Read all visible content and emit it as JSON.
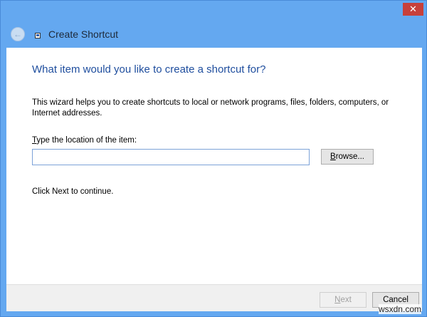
{
  "window": {
    "title": "Create Shortcut",
    "close_label": "✕"
  },
  "main": {
    "heading": "What item would you like to create a shortcut for?",
    "description": "This wizard helps you to create shortcuts to local or network programs, files, folders, computers, or Internet addresses.",
    "location_label_first": "T",
    "location_label_rest": "ype the location of the item:",
    "location_value": "",
    "browse_first": "B",
    "browse_rest": "rowse...",
    "hint": "Click Next to continue."
  },
  "footer": {
    "next_first": "N",
    "next_rest": "ext",
    "cancel": "Cancel"
  },
  "watermark": "wsxdn.com"
}
